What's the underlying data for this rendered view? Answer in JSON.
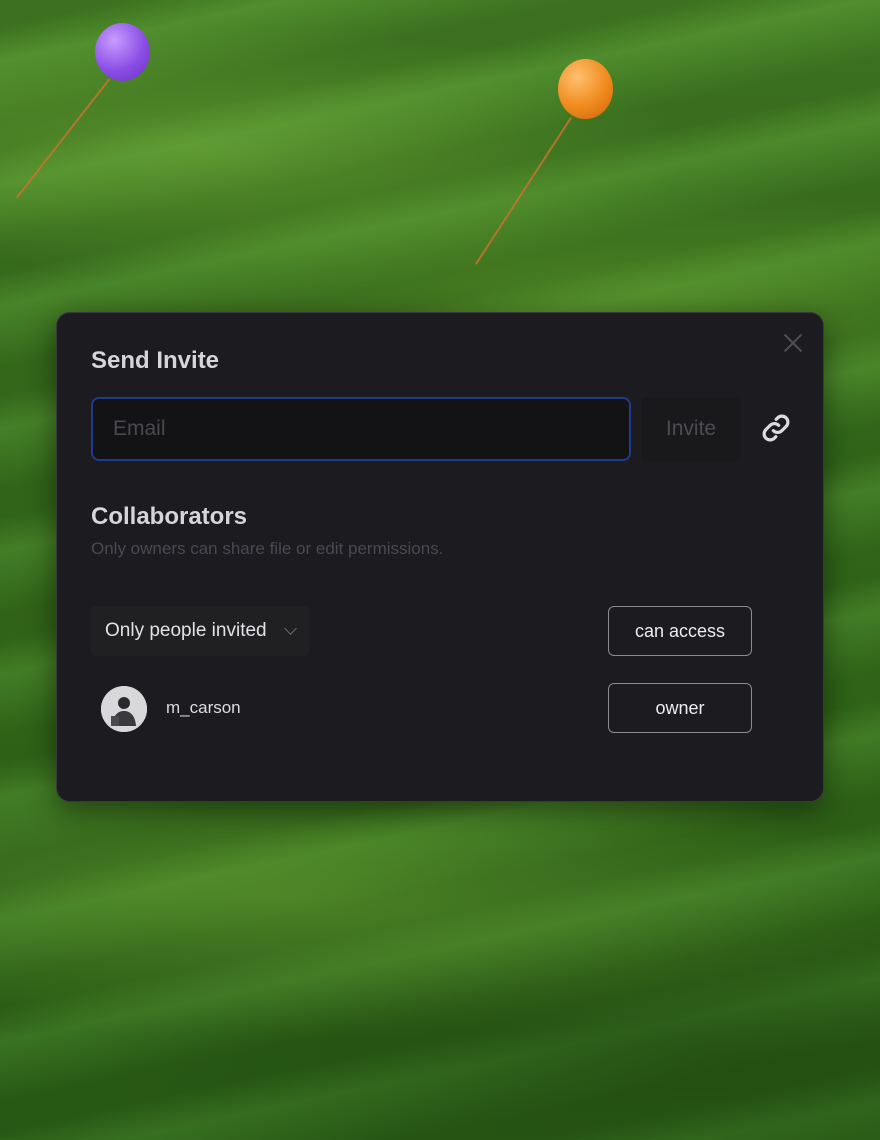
{
  "dialog": {
    "title": "Send Invite",
    "email_placeholder": "Email",
    "email_value": "",
    "invite_label": "Invite",
    "link_icon": "link-icon",
    "close_icon": "close-icon"
  },
  "collaborators": {
    "heading": "Collaborators",
    "hint": "Only owners can share file or edit permissions.",
    "access_selected": "Only people invited",
    "access_permission": "can access",
    "members": [
      {
        "username": "m_carson",
        "role": "owner"
      }
    ]
  },
  "colors": {
    "modal_bg": "#1c1b1f",
    "input_focus_border": "#1f3c8a",
    "muted_text": "#4a4950"
  }
}
